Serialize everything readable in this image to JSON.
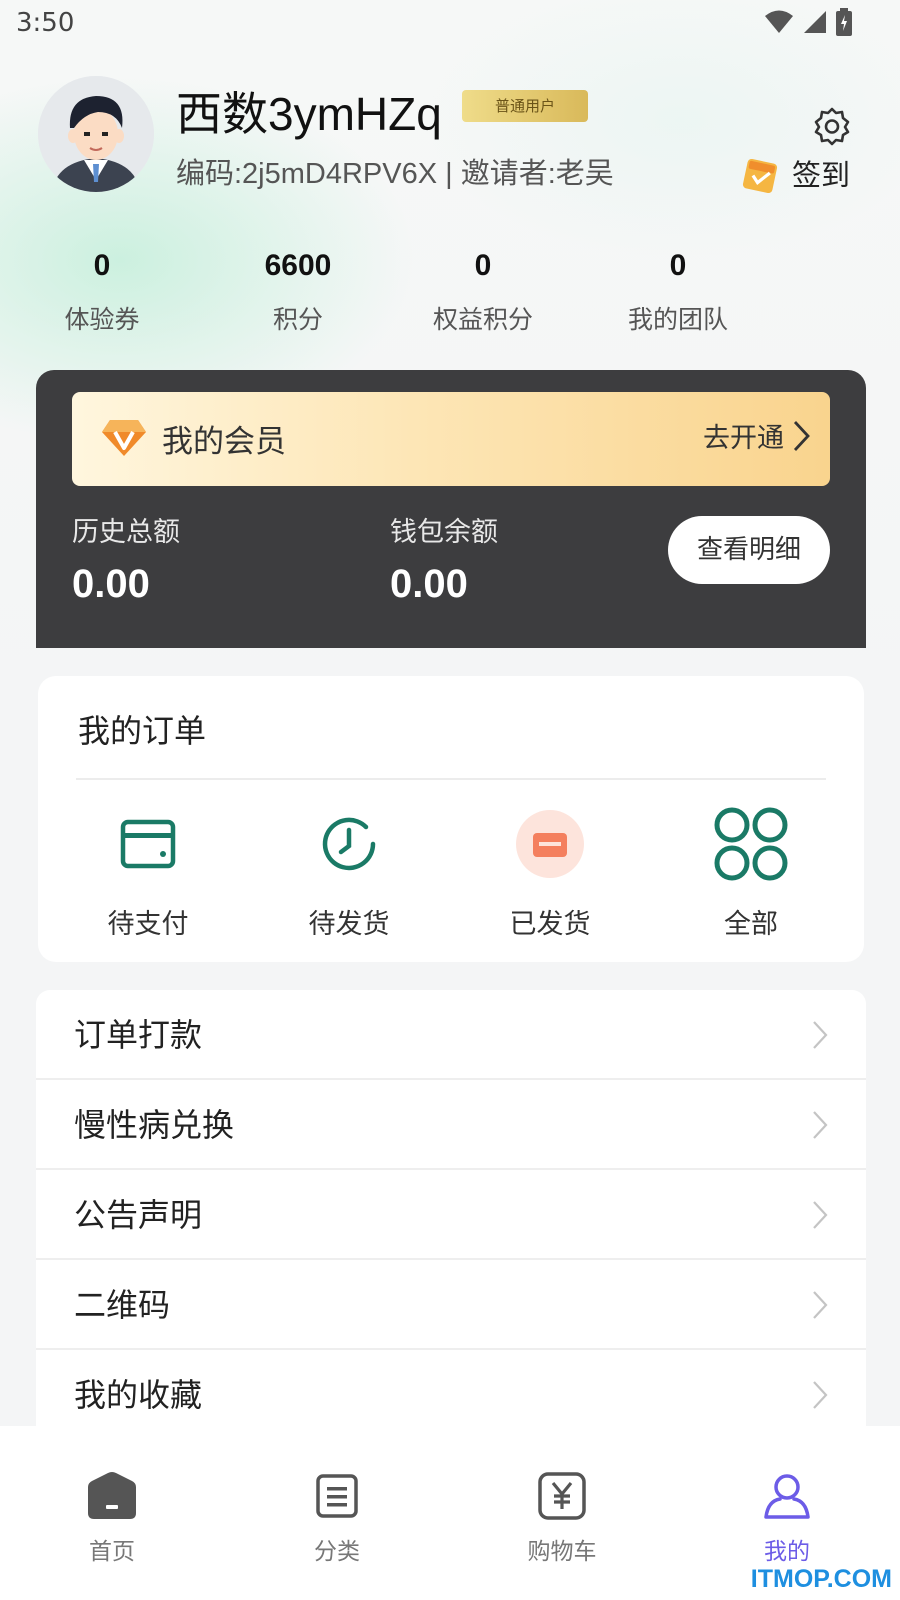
{
  "status_bar": {
    "time": "3:50"
  },
  "profile": {
    "username": "西数3ymHZq",
    "badge": "普通用户",
    "code_line": "编码:2j5mD4RPV6X | 邀请者:老吴",
    "signin_label": "签到"
  },
  "stats": [
    {
      "value": "0",
      "label": "体验券"
    },
    {
      "value": "6600",
      "label": "积分"
    },
    {
      "value": "0",
      "label": "权益积分"
    },
    {
      "value": "0",
      "label": "我的团队"
    }
  ],
  "member": {
    "title": "我的会员",
    "open_label": "去开通",
    "history_label": "历史总额",
    "history_value": "0.00",
    "balance_label": "钱包余额",
    "balance_value": "0.00",
    "detail_button": "查看明细"
  },
  "orders": {
    "title": "我的订单",
    "items": [
      {
        "label": "待支付",
        "icon": "wallet-icon"
      },
      {
        "label": "待发货",
        "icon": "clock-icon"
      },
      {
        "label": "已发货",
        "icon": "card-icon"
      },
      {
        "label": "全部",
        "icon": "grid-icon"
      }
    ]
  },
  "menu": {
    "items": [
      {
        "label": "订单打款"
      },
      {
        "label": "慢性病兑换"
      },
      {
        "label": "公告声明"
      },
      {
        "label": "二维码"
      },
      {
        "label": "我的收藏"
      }
    ]
  },
  "tab_bar": {
    "items": [
      {
        "label": "首页",
        "icon": "home-icon"
      },
      {
        "label": "分类",
        "icon": "category-icon"
      },
      {
        "label": "购物车",
        "icon": "cart-icon"
      },
      {
        "label": "我的",
        "icon": "user-icon"
      }
    ],
    "active_color": "#6c5ce7"
  },
  "watermark": "ITMOP.COM",
  "colors": {
    "accent_green": "#1a7a66",
    "card_dark": "#3d3d3f",
    "shipped_orange": "#f47f5e"
  }
}
